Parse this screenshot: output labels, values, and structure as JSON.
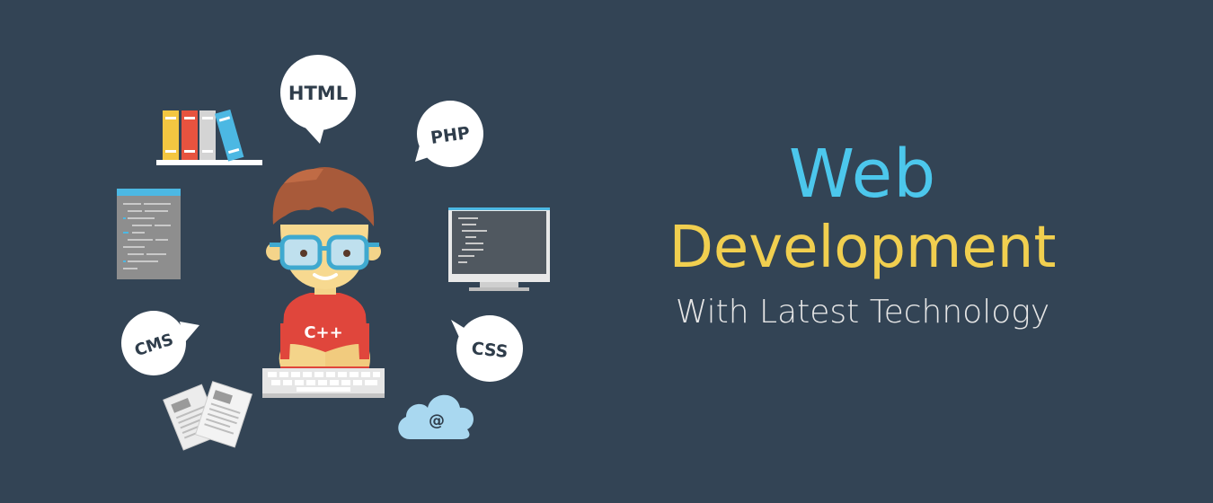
{
  "headline": {
    "title": "Web",
    "subtitle_main": "Development",
    "tagline": "With Latest Technology"
  },
  "bubbles": {
    "html": "HTML",
    "php": "PHP",
    "cms": "CMS",
    "css": "CSS"
  },
  "shirt_text": "C++",
  "cloud_symbol": "@",
  "colors": {
    "background": "#334455",
    "title_blue": "#4cc7ec",
    "title_yellow": "#f1cf4f",
    "tagline": "#e6e6e6",
    "shirt_red": "#e0463c"
  }
}
